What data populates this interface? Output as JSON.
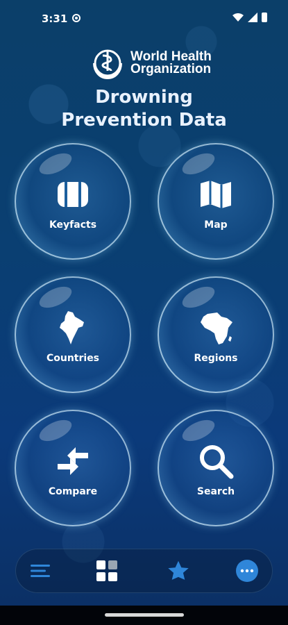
{
  "status_bar": {
    "time": "3:31",
    "icons": [
      "sync-icon",
      "wifi-icon",
      "signal-icon",
      "battery-icon"
    ]
  },
  "header": {
    "org_name_line1": "World Health",
    "org_name_line2": "Organization",
    "title_line1": "Drowning",
    "title_line2": "Prevention Data",
    "emblem_icon": "who-emblem-icon"
  },
  "tiles": [
    {
      "label": "Keyfacts",
      "icon": "keyfacts-icon"
    },
    {
      "label": "Map",
      "icon": "map-icon"
    },
    {
      "label": "Countries",
      "icon": "india-map-icon"
    },
    {
      "label": "Regions",
      "icon": "africa-map-icon"
    },
    {
      "label": "Compare",
      "icon": "compare-arrows-icon"
    },
    {
      "label": "Search",
      "icon": "search-icon"
    }
  ],
  "bottom_nav": {
    "items": [
      {
        "icon": "menu-lines-icon"
      },
      {
        "icon": "grid-icon"
      },
      {
        "icon": "star-icon"
      },
      {
        "icon": "more-icon"
      }
    ]
  },
  "colors": {
    "background_top": "#0b3f69",
    "background_bottom": "#0b2f63",
    "accent_blue": "#2f86d9",
    "text": "#ffffff"
  }
}
